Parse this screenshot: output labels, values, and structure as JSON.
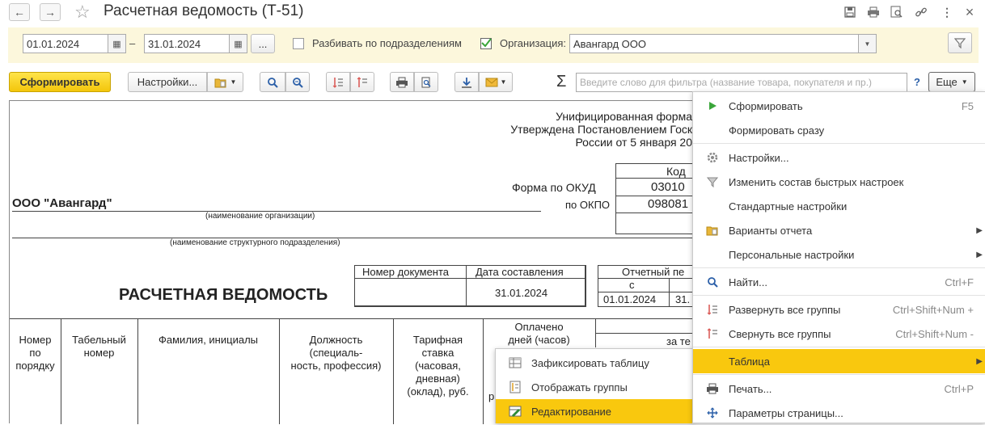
{
  "window": {
    "title": "Расчетная ведомость (Т-51)",
    "back": "←",
    "forward": "→",
    "star": "☆",
    "icons": [
      "save-icon",
      "print-icon",
      "preview-icon",
      "link-icon",
      "more-icon",
      "close-icon"
    ],
    "more_label": "⋮",
    "close_label": "×"
  },
  "filters": {
    "date_from": "01.01.2024",
    "dash": "–",
    "date_to": "31.01.2024",
    "dots": "...",
    "split_label": "Разбивать по подразделениям",
    "org_label": "Организация:",
    "org_value": "Авангард ООО"
  },
  "toolbar": {
    "form": "Сформировать",
    "settings": "Настройки...",
    "sigma": "Σ",
    "search_placeholder": "Введите слово для фильтра (название товара, покупателя и пр.)",
    "help": "?",
    "more": "Еще"
  },
  "doc": {
    "unified": "Унифицированная форма",
    "approved": "Утверждена Постановлением Госк",
    "russia": "России от 5 января 20",
    "code": "Код",
    "okud_label": "Форма по ОКУД",
    "okud": "03010",
    "okpo_label": "по ОКПО",
    "okpo": "098081",
    "org": "ООО \"Авангард\"",
    "org_caption": "(наименование организации)",
    "dept_caption": "(наименование структурного подразделения)",
    "doc_num_label": "Номер документа",
    "doc_date_label": "Дата составления",
    "doc_date": "31.01.2024",
    "period_label": "Отчетный пе",
    "from_label": "с",
    "period_from": "01.01.2024",
    "period_to": "31.",
    "heading": "РАСЧЕТНАЯ ВЕДОМОСТЬ",
    "col1": "Номер\nпо\nпорядку",
    "col2": "Табельный\nномер",
    "col3": "Фамилия, инициалы",
    "col4": "Должность\n(специаль-\nность, профессия)",
    "col5": "Тарифная\nставка\n(часовая,\nдневная)\n(оклад), руб.",
    "col6": "Оплачено\nдней (часов)",
    "col7": "за те",
    "col6b": "р"
  },
  "menu": {
    "items": [
      {
        "label": "Сформировать",
        "shortcut": "F5"
      },
      {
        "label": "Формировать сразу",
        "shortcut": ""
      },
      {
        "label": "Настройки...",
        "shortcut": ""
      },
      {
        "label": "Изменить состав быстрых настроек",
        "shortcut": ""
      },
      {
        "label": "Стандартные настройки",
        "shortcut": ""
      },
      {
        "label": "Варианты отчета",
        "shortcut": ""
      },
      {
        "label": "Персональные настройки",
        "shortcut": ""
      },
      {
        "label": "Найти...",
        "shortcut": "Ctrl+F"
      },
      {
        "label": "Развернуть все группы",
        "shortcut": "Ctrl+Shift+Num +"
      },
      {
        "label": "Свернуть все группы",
        "shortcut": "Ctrl+Shift+Num -"
      },
      {
        "label": "Таблица",
        "shortcut": ""
      },
      {
        "label": "Печать...",
        "shortcut": "Ctrl+P"
      },
      {
        "label": "Параметры страницы...",
        "shortcut": ""
      }
    ]
  },
  "submenu": {
    "items": [
      {
        "label": "Зафиксировать таблицу"
      },
      {
        "label": "Отображать группы"
      },
      {
        "label": "Редактирование"
      }
    ]
  },
  "colors": {
    "accent": "#f9c80e",
    "panel": "#fcf7dc",
    "play": "#3aa63a"
  }
}
